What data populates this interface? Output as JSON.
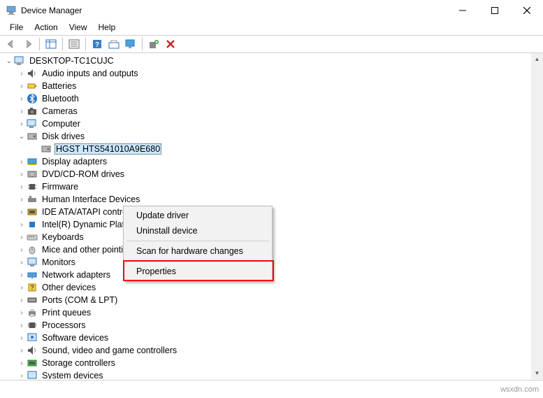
{
  "window": {
    "title": "Device Manager"
  },
  "menu": {
    "file": "File",
    "action": "Action",
    "view": "View",
    "help": "Help"
  },
  "tree": {
    "root": "DESKTOP-TC1CUJC",
    "audio": "Audio inputs and outputs",
    "batteries": "Batteries",
    "bluetooth": "Bluetooth",
    "cameras": "Cameras",
    "computer": "Computer",
    "disk_drives": "Disk drives",
    "disk0": "HGST HTS541010A9E680",
    "display_adapters": "Display adapters",
    "dvd": "DVD/CD-ROM drives",
    "firmware": "Firmware",
    "hid": "Human Interface Devices",
    "ide": "IDE ATA/ATAPI controllers",
    "intel_platform": "Intel(R) Dynamic Platform and Thermal Framework",
    "keyboards": "Keyboards",
    "mice": "Mice and other pointing devices",
    "monitors": "Monitors",
    "network": "Network adapters",
    "other": "Other devices",
    "ports": "Ports (COM & LPT)",
    "print_queues": "Print queues",
    "processors": "Processors",
    "software": "Software devices",
    "sound": "Sound, video and game controllers",
    "storage": "Storage controllers",
    "system": "System devices"
  },
  "context_menu": {
    "update_driver": "Update driver",
    "uninstall": "Uninstall device",
    "scan": "Scan for hardware changes",
    "properties": "Properties"
  },
  "watermark": "wsxdn.com"
}
